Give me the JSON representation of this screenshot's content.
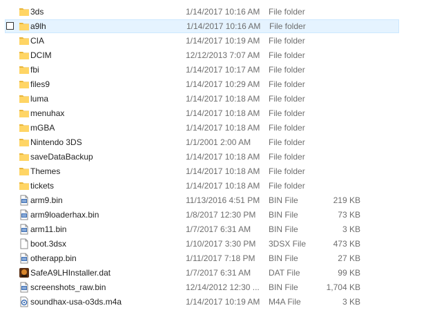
{
  "files": [
    {
      "name": "3ds",
      "date": "1/14/2017 10:16 AM",
      "type": "File folder",
      "size": "",
      "icon": "folder-icon"
    },
    {
      "name": "a9lh",
      "date": "1/14/2017 10:16 AM",
      "type": "File folder",
      "size": "",
      "icon": "folder-icon",
      "hovered": true
    },
    {
      "name": "CIA",
      "date": "1/14/2017 10:19 AM",
      "type": "File folder",
      "size": "",
      "icon": "folder-icon"
    },
    {
      "name": "DCIM",
      "date": "12/12/2013 7:07 AM",
      "type": "File folder",
      "size": "",
      "icon": "folder-icon"
    },
    {
      "name": "fbi",
      "date": "1/14/2017 10:17 AM",
      "type": "File folder",
      "size": "",
      "icon": "folder-icon"
    },
    {
      "name": "files9",
      "date": "1/14/2017 10:29 AM",
      "type": "File folder",
      "size": "",
      "icon": "folder-icon"
    },
    {
      "name": "luma",
      "date": "1/14/2017 10:18 AM",
      "type": "File folder",
      "size": "",
      "icon": "folder-icon"
    },
    {
      "name": "menuhax",
      "date": "1/14/2017 10:18 AM",
      "type": "File folder",
      "size": "",
      "icon": "folder-icon"
    },
    {
      "name": "mGBA",
      "date": "1/14/2017 10:18 AM",
      "type": "File folder",
      "size": "",
      "icon": "folder-icon"
    },
    {
      "name": "Nintendo 3DS",
      "date": "1/1/2001 2:00 AM",
      "type": "File folder",
      "size": "",
      "icon": "folder-icon"
    },
    {
      "name": "saveDataBackup",
      "date": "1/14/2017 10:18 AM",
      "type": "File folder",
      "size": "",
      "icon": "folder-icon"
    },
    {
      "name": "Themes",
      "date": "1/14/2017 10:18 AM",
      "type": "File folder",
      "size": "",
      "icon": "folder-icon"
    },
    {
      "name": "tickets",
      "date": "1/14/2017 10:18 AM",
      "type": "File folder",
      "size": "",
      "icon": "folder-icon"
    },
    {
      "name": "arm9.bin",
      "date": "11/13/2016 4:51 PM",
      "type": "BIN File",
      "size": "219 KB",
      "icon": "bin-file-icon"
    },
    {
      "name": "arm9loaderhax.bin",
      "date": "1/8/2017 12:30 PM",
      "type": "BIN File",
      "size": "73 KB",
      "icon": "bin-file-icon"
    },
    {
      "name": "arm11.bin",
      "date": "1/7/2017 6:31 AM",
      "type": "BIN File",
      "size": "3 KB",
      "icon": "bin-file-icon"
    },
    {
      "name": "boot.3dsx",
      "date": "1/10/2017 3:30 PM",
      "type": "3DSX File",
      "size": "473 KB",
      "icon": "blank-file-icon"
    },
    {
      "name": "otherapp.bin",
      "date": "1/11/2017 7:18 PM",
      "type": "BIN File",
      "size": "27 KB",
      "icon": "bin-file-icon"
    },
    {
      "name": "SafeA9LHInstaller.dat",
      "date": "1/7/2017 6:31 AM",
      "type": "DAT File",
      "size": "99 KB",
      "icon": "game-thumbnail-icon"
    },
    {
      "name": "screenshots_raw.bin",
      "date": "12/14/2012 12:30 ...",
      "type": "BIN File",
      "size": "1,704 KB",
      "icon": "bin-file-icon"
    },
    {
      "name": "soundhax-usa-o3ds.m4a",
      "date": "1/14/2017 10:19 AM",
      "type": "M4A File",
      "size": "3 KB",
      "icon": "audio-file-icon"
    }
  ],
  "colors": {
    "folder": "#ffd565",
    "folder_dark": "#e8b53a",
    "hover_bg": "#e5f3ff",
    "hover_border": "#cce8ff",
    "bin_blue": "#3d6fb5"
  }
}
